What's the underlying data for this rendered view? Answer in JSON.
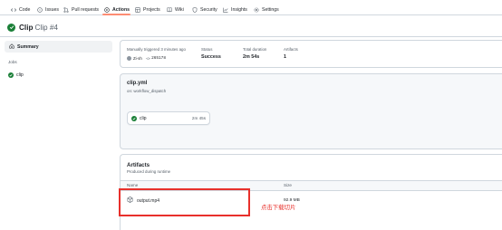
{
  "nav": {
    "tabs": [
      {
        "label": "Code",
        "icon": "code-icon"
      },
      {
        "label": "Issues",
        "icon": "issue-opened-icon"
      },
      {
        "label": "Pull requests",
        "icon": "git-pull-request-icon"
      },
      {
        "label": "Actions",
        "icon": "play-icon",
        "active": true
      },
      {
        "label": "Projects",
        "icon": "table-icon"
      },
      {
        "label": "Wiki",
        "icon": "book-icon"
      },
      {
        "label": "Security",
        "icon": "shield-icon"
      },
      {
        "label": "Insights",
        "icon": "graph-icon"
      },
      {
        "label": "Settings",
        "icon": "gear-icon"
      }
    ],
    "accent": "#fd8c73"
  },
  "run": {
    "workflow": "Clip",
    "run_title": "Clip #4",
    "status_color": "#1a7f37"
  },
  "sidebar": {
    "summary_label": "Summary",
    "jobs_heading": "Jobs",
    "jobs": [
      {
        "name": "clip"
      }
    ]
  },
  "summary": {
    "trigger_label": "Manually triggered 3 minutes ago",
    "user": "Zi-sh",
    "commit_prefix": "-o-",
    "commit_sha": "265178",
    "status_label": "Status",
    "status_value": "Success",
    "duration_label": "Total duration",
    "duration_value": "2m 54s",
    "artifacts_label": "Artifacts",
    "artifacts_value": "1"
  },
  "workflow_graph": {
    "file": "clip.yml",
    "trigger": "on: workflow_dispatch",
    "job": {
      "name": "clip",
      "duration": "2m 45s"
    }
  },
  "artifacts": {
    "title": "Artifacts",
    "subtitle": "Produced during runtime",
    "col_name": "Name",
    "col_size": "Size",
    "items": [
      {
        "name": "output.mp4",
        "size": "92.9 MB",
        "icon": "package-icon"
      }
    ]
  },
  "annotation": {
    "text": "点击下载切片",
    "color": "#e8302b"
  }
}
